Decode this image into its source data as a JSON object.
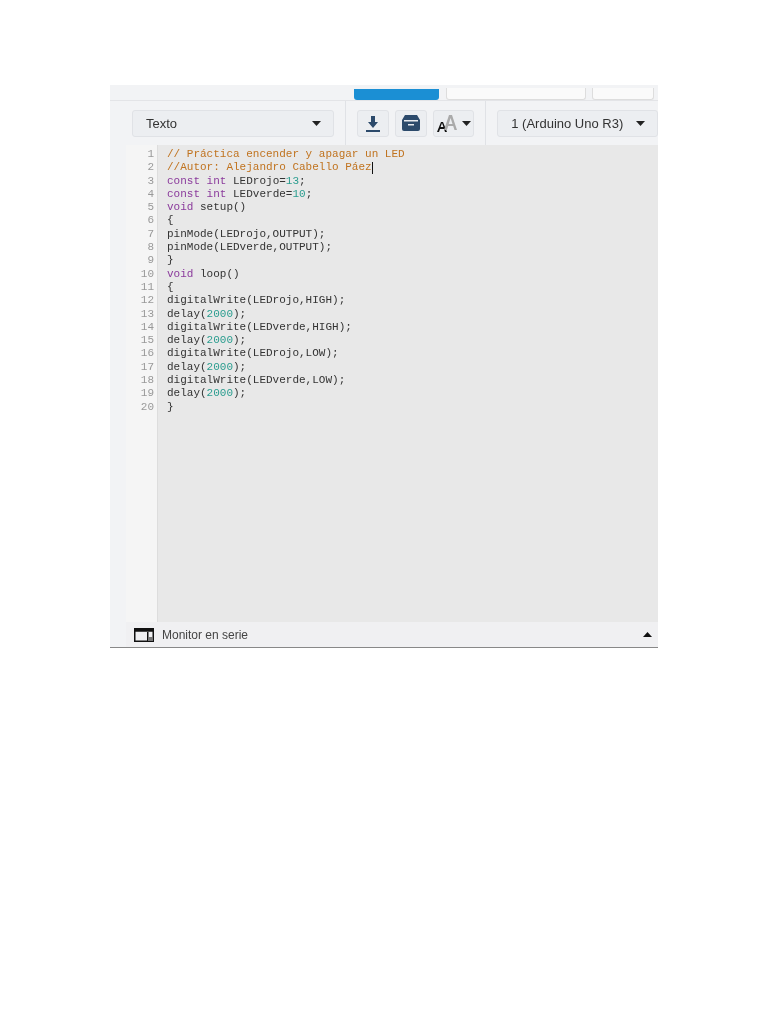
{
  "toolbar": {
    "mode_select": {
      "value": "Texto"
    },
    "component_select": {
      "value": "1 (Arduino Uno R3)"
    }
  },
  "editor": {
    "lines": [
      {
        "number": "1",
        "tokens": [
          {
            "kind": "comment",
            "text": "// Práctica encender y apagar un LED"
          }
        ]
      },
      {
        "number": "2",
        "tokens": [
          {
            "kind": "comment",
            "text": "//Autor: Alejandro Cabello Páez"
          }
        ],
        "cursor": true
      },
      {
        "number": "3",
        "tokens": [
          {
            "kind": "keyword",
            "text": "const int"
          },
          {
            "kind": "plain",
            "text": " LEDrojo="
          },
          {
            "kind": "number",
            "text": "13"
          },
          {
            "kind": "plain",
            "text": ";"
          }
        ]
      },
      {
        "number": "4",
        "tokens": [
          {
            "kind": "keyword",
            "text": "const int"
          },
          {
            "kind": "plain",
            "text": " LEDverde="
          },
          {
            "kind": "number",
            "text": "10"
          },
          {
            "kind": "plain",
            "text": ";"
          }
        ]
      },
      {
        "number": "5",
        "tokens": [
          {
            "kind": "keyword",
            "text": "void"
          },
          {
            "kind": "plain",
            "text": " setup()"
          }
        ]
      },
      {
        "number": "6",
        "tokens": [
          {
            "kind": "plain",
            "text": "{"
          }
        ]
      },
      {
        "number": "7",
        "tokens": [
          {
            "kind": "plain",
            "text": "pinMode(LEDrojo,OUTPUT);"
          }
        ]
      },
      {
        "number": "8",
        "tokens": [
          {
            "kind": "plain",
            "text": "pinMode(LEDverde,OUTPUT);"
          }
        ]
      },
      {
        "number": "9",
        "tokens": [
          {
            "kind": "plain",
            "text": "}"
          }
        ]
      },
      {
        "number": "10",
        "tokens": [
          {
            "kind": "keyword",
            "text": "void"
          },
          {
            "kind": "plain",
            "text": " loop()"
          }
        ]
      },
      {
        "number": "11",
        "tokens": [
          {
            "kind": "plain",
            "text": "{"
          }
        ]
      },
      {
        "number": "12",
        "tokens": [
          {
            "kind": "plain",
            "text": "digitalWrite(LEDrojo,HIGH);"
          }
        ]
      },
      {
        "number": "13",
        "tokens": [
          {
            "kind": "plain",
            "text": "delay("
          },
          {
            "kind": "number",
            "text": "2000"
          },
          {
            "kind": "plain",
            "text": ");"
          }
        ]
      },
      {
        "number": "14",
        "tokens": [
          {
            "kind": "plain",
            "text": "digitalWrite(LEDverde,HIGH);"
          }
        ]
      },
      {
        "number": "15",
        "tokens": [
          {
            "kind": "plain",
            "text": "delay("
          },
          {
            "kind": "number",
            "text": "2000"
          },
          {
            "kind": "plain",
            "text": ");"
          }
        ]
      },
      {
        "number": "16",
        "tokens": [
          {
            "kind": "plain",
            "text": "digitalWrite(LEDrojo,LOW);"
          }
        ]
      },
      {
        "number": "17",
        "tokens": [
          {
            "kind": "plain",
            "text": "delay("
          },
          {
            "kind": "number",
            "text": "2000"
          },
          {
            "kind": "plain",
            "text": ");"
          }
        ]
      },
      {
        "number": "18",
        "tokens": [
          {
            "kind": "plain",
            "text": "digitalWrite(LEDverde,LOW);"
          }
        ]
      },
      {
        "number": "19",
        "tokens": [
          {
            "kind": "plain",
            "text": "delay("
          },
          {
            "kind": "number",
            "text": "2000"
          },
          {
            "kind": "plain",
            "text": ");"
          }
        ]
      },
      {
        "number": "20",
        "tokens": [
          {
            "kind": "plain",
            "text": "}"
          }
        ]
      }
    ]
  },
  "serial_monitor": {
    "label": "Monitor en serie",
    "expanded": false
  }
}
